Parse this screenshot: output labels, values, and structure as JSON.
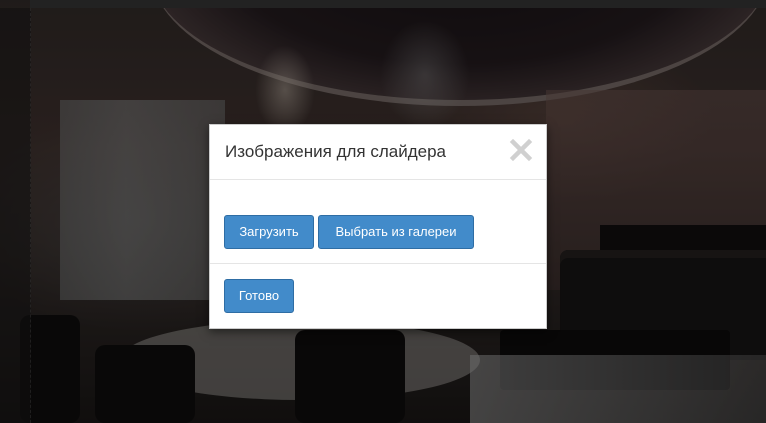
{
  "modal": {
    "title": "Изображения для слайдера",
    "close_icon": "close-icon",
    "body": {
      "upload_label": "Загрузить",
      "gallery_label": "Выбрать из галереи"
    },
    "footer": {
      "done_label": "Готово"
    }
  },
  "colors": {
    "primary_button": "#428bca",
    "primary_button_border": "#2e6da4",
    "close_icon": "#d0d0d0",
    "title_text": "#333333"
  }
}
